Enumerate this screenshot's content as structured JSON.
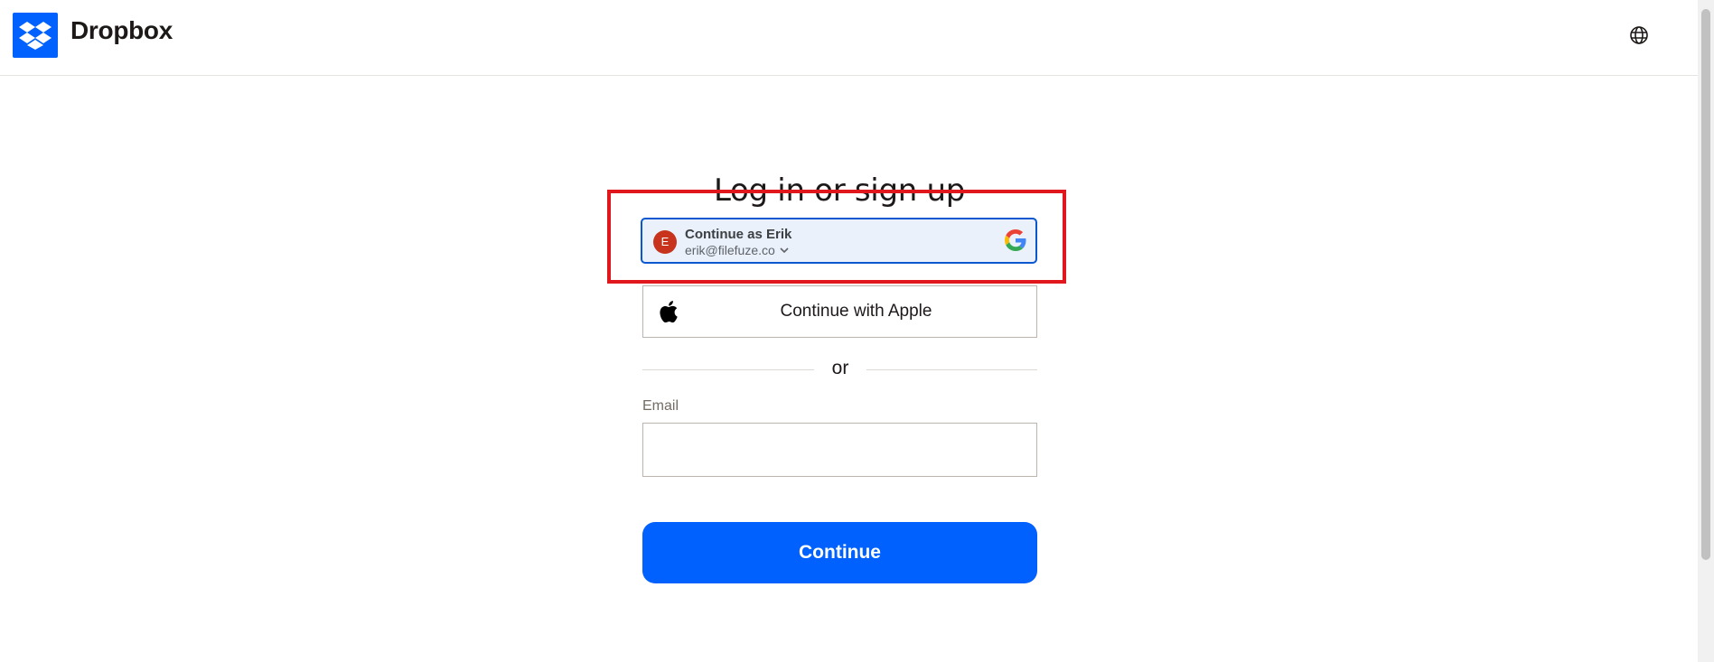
{
  "header": {
    "brand": "Dropbox",
    "logo_icon": "dropbox-logo-icon",
    "language_icon": "globe-icon"
  },
  "main": {
    "title": "Log in or sign up",
    "google_account": {
      "avatar_initial": "E",
      "name_label": "Continue as Erik",
      "email": "erik@filefuze.co",
      "icon": "google-g-icon"
    },
    "apple": {
      "label": "Continue with Apple",
      "icon": "apple-icon"
    },
    "divider_text": "or",
    "email_field": {
      "label": "Email",
      "value": "",
      "placeholder": ""
    },
    "continue_label": "Continue"
  },
  "colors": {
    "accent": "#0061fe",
    "highlight_box": "#e0171d",
    "google_card_bg": "#eaf1fb",
    "google_card_border": "#0b57d0",
    "avatar_bg": "#c7331c"
  }
}
